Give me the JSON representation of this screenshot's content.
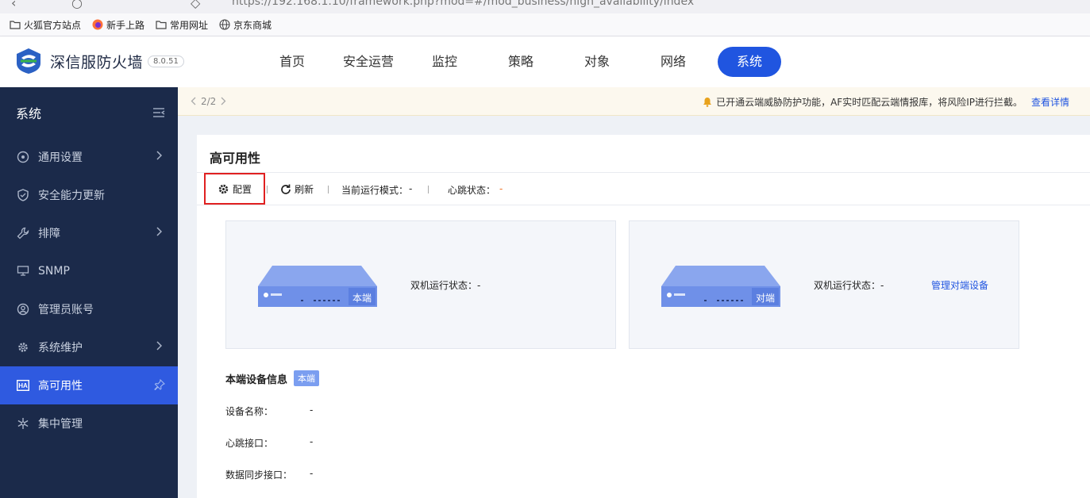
{
  "browser": {
    "url": "https://192.168.1.10/framework.php?mod=#/mod_business/high_availability/index",
    "bookmarks": [
      {
        "label": "火狐官方站点",
        "icon": "folder-icon"
      },
      {
        "label": "新手上路",
        "icon": "firefox-icon"
      },
      {
        "label": "常用网址",
        "icon": "folder-icon"
      },
      {
        "label": "京东商城",
        "icon": "globe-icon"
      }
    ]
  },
  "header": {
    "brand": "深信服防火墙",
    "version": "8.0.51",
    "nav": [
      "首页",
      "安全运营",
      "监控",
      "策略",
      "对象",
      "网络",
      "系统"
    ],
    "active_nav": "系统"
  },
  "sidebar": {
    "title": "系统",
    "items": [
      {
        "label": "通用设置",
        "icon": "gear-circle-icon",
        "has_children": true
      },
      {
        "label": "安全能力更新",
        "icon": "shield-icon",
        "has_children": false
      },
      {
        "label": "排障",
        "icon": "wrench-icon",
        "has_children": true
      },
      {
        "label": "SNMP",
        "icon": "network-icon",
        "has_children": false
      },
      {
        "label": "管理员账号",
        "icon": "user-circle-icon",
        "has_children": false
      },
      {
        "label": "系统维护",
        "icon": "cog-icon",
        "has_children": true
      },
      {
        "label": "高可用性",
        "icon": "ha-icon",
        "has_children": false,
        "active": true
      },
      {
        "label": "集中管理",
        "icon": "snowflake-icon",
        "has_children": false
      }
    ]
  },
  "notice": {
    "pager": "2/2",
    "message": "已开通云端威胁防护功能，AF实时匹配云端情报库，将风险IP进行拦截。",
    "link": "查看详情"
  },
  "panel": {
    "title": "高可用性",
    "toolbar": {
      "config": "配置",
      "refresh": "刷新",
      "mode_label": "当前运行模式：",
      "mode_value": "-",
      "heartbeat_label": "心跳状态：",
      "heartbeat_value": "-"
    },
    "local_card": {
      "device_label": "本端",
      "status_label": "双机运行状态：",
      "status_value": "-"
    },
    "peer_card": {
      "device_label": "对端",
      "status_label": "双机运行状态：",
      "status_value": "-",
      "link": "管理对端设备"
    },
    "info": {
      "title": "本端设备信息",
      "tag": "本端",
      "rows": [
        {
          "key": "设备名称：",
          "value": "-"
        },
        {
          "key": "心跳接口：",
          "value": "-"
        },
        {
          "key": "数据同步接口：",
          "value": "-"
        }
      ]
    }
  },
  "colors": {
    "primary": "#2055e0",
    "sidebar_bg": "#1b2a4a",
    "highlight_border": "#e02020",
    "warning": "#f07020"
  }
}
